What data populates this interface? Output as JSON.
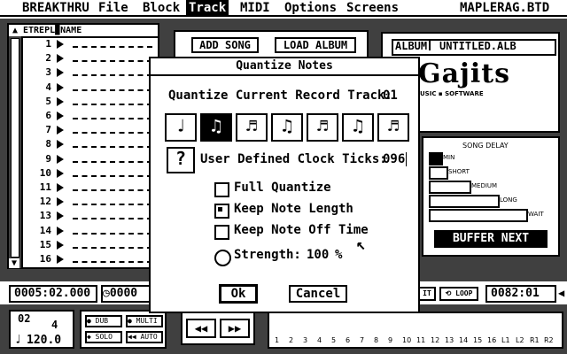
{
  "menubar": {
    "app": "BREAKTHRU",
    "file": "File",
    "block": "Block",
    "track": "Track",
    "midi": "MIDI",
    "options": "Options",
    "screens": "Screens",
    "filename": "MAPLERAG.BTD"
  },
  "tracklist": {
    "header": "ETREPL▉NAME",
    "numbers": [
      "1",
      "2",
      "3",
      "4",
      "5",
      "6",
      "7",
      "8",
      "9",
      "10",
      "11",
      "12",
      "13",
      "14",
      "15",
      "16"
    ]
  },
  "top_buttons": {
    "add_song": "ADD SONG",
    "load_album": "LOAD ALBUM"
  },
  "album": {
    "label": "ALBUM",
    "name": "UNTITLED.ALB"
  },
  "logo": {
    "brand": "Gajits",
    "tagline": "USIC ▪ SOFTWARE"
  },
  "dialog": {
    "title": "Quantize Notes",
    "record_track_label": "Quantize Current Record Track:",
    "record_track_value": "01",
    "note_glyphs": [
      "♩",
      "♫",
      "♬",
      "♫",
      "♬",
      "♫",
      "♬"
    ],
    "help_glyph": "?",
    "clock_label": "User Defined Clock Ticks:",
    "clock_value": "096",
    "full_quantize": "Full Quantize",
    "keep_length": "Keep Note Length",
    "keep_off_time": "Keep Note Off Time",
    "strength_label": "Strength:",
    "strength_value": "100",
    "strength_unit": "%",
    "ok": "Ok",
    "cancel": "Cancel"
  },
  "song_delay": {
    "title": "SONG DELAY",
    "min": "MIN",
    "short": "SHORT",
    "medium": "MEDIUM",
    "long": "LONG",
    "wait": "WAIT"
  },
  "buffer_next": "BUFFER NEXT",
  "transport": {
    "position": "0005:02.000",
    "clock": "0000",
    "loop": "LOOP",
    "it": "IT",
    "counter": "0082:01",
    "time_sig_top": "02",
    "time_sig_bottom": "4",
    "tempo": "120.0",
    "dub": "DUB",
    "multi": "MULTI",
    "solo": "SOLO",
    "auto": "AUTO",
    "rewind": "◀◀",
    "ffwd": "▶▶",
    "channels": [
      "1",
      "2",
      "3",
      "4",
      "5",
      "6",
      "7",
      "8",
      "9",
      "10",
      "11",
      "12",
      "13",
      "14",
      "15",
      "16",
      "L1",
      "L2",
      "R1",
      "R2"
    ]
  }
}
